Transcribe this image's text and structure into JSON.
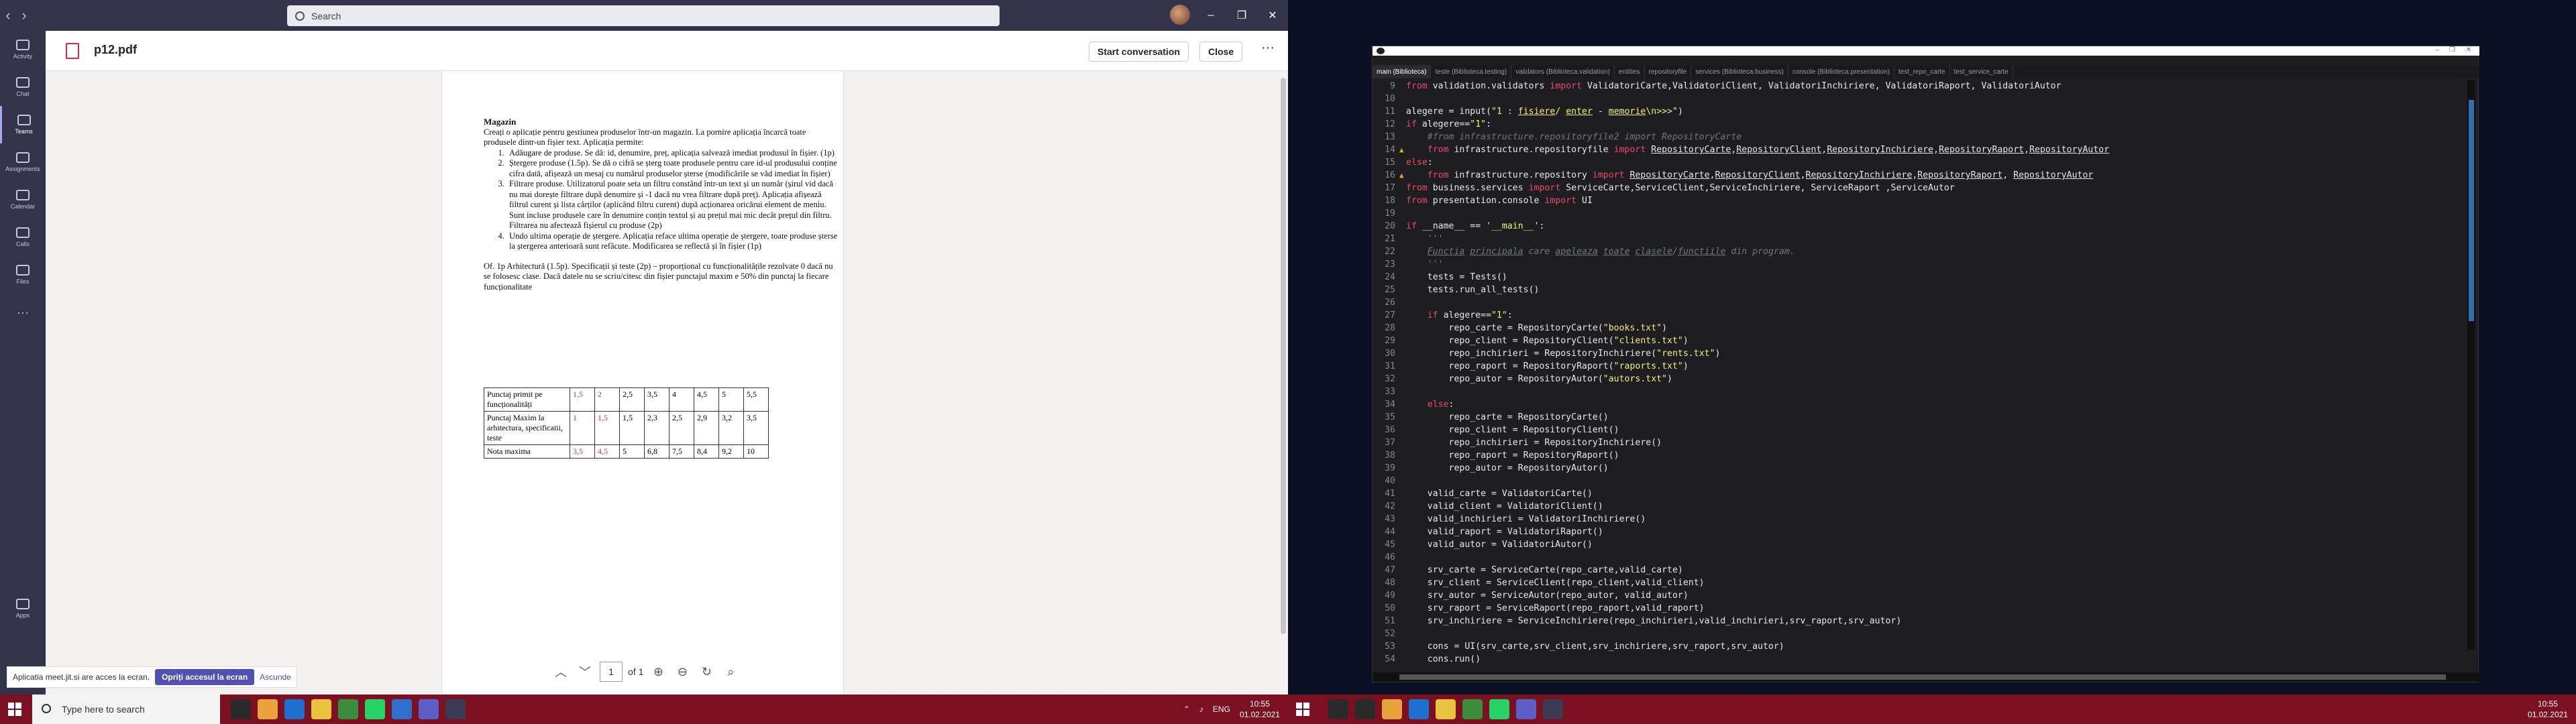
{
  "teams": {
    "search_placeholder": "Search",
    "window_buttons": [
      "–",
      "❐",
      "✕"
    ],
    "rail": [
      "Activity",
      "Chat",
      "Teams",
      "Assignments",
      "Calendar",
      "Calls",
      "Files",
      "Apps"
    ],
    "doc_title": "p12.pdf",
    "start_conversation": "Start conversation",
    "close": "Close",
    "pdf": {
      "heading": "Magazin",
      "intro": "Creați o aplicație pentru gestiunea produselor într-un magazin. La pornire aplicația încarcă toate produsele dintr-un fișier text. Aplicația permite:",
      "items": [
        "Adăugare de produse. Se dă: id, denumire, preț, aplicația salvează imediat produsul în fișier. (1p)",
        "Ștergere produse (1.5p). Se dă o cifră se șterg toate produsele pentru care id-ul produsului conține cifra dată, afișează un mesaj cu numărul produselor șterse (modificările se văd imediat în fișier)",
        "Filtrare produse. Utilizatorul poate seta un filtru constând într-un text și un număr (șirul vid dacă nu mai dorește filtrare după denumire și -1 dacă nu vrea filtrare după preț). Aplicația afișează filtrul curent și lista cărților (aplicând filtru curent) după acționarea oricărui element de meniu. Sunt incluse produsele care în denumire conțin textul și au prețul mai mic decât prețul din filtru. Filtrarea nu afectează fișierul cu produse (2p)",
        "Undo ultima operație de ștergere. Aplicația reface ultima operație de ștergere, toate produse șterse la ștergerea anterioară sunt refăcute. Modificarea se reflectă și în fișier (1p)"
      ],
      "footer": "Of. 1p Arhitectură (1.5p). Specificații și teste (2p) – proporțional cu funcționalitățile rezolvate 0 dacă nu se folosesc clase. Dacă datele nu se scriu/citesc din fișier punctajul maxim e 50% din punctaj la fiecare funcționalitate",
      "table": [
        [
          "Punctaj primit pe funcționalități",
          "1,5",
          "2",
          "2,5",
          "3,5",
          "4",
          "4,5",
          "5",
          "5,5"
        ],
        [
          "Punctaj Maxim la arhitectura, specificatii, teste",
          "1",
          "1,5",
          "1,5",
          "2,3",
          "2,5",
          "2,9",
          "3,2",
          "3,5"
        ],
        [
          "Nota maxima",
          "3,5",
          "4,5",
          "5",
          "6,8",
          "7,5",
          "8,4",
          "9,2",
          "10"
        ]
      ],
      "page_num": "1",
      "page_of": "of 1"
    },
    "notification": {
      "text": "Aplicatia meet.jit.si are acces la ecran.",
      "share": "Opriți accesul la ecran",
      "hide": "Ascunde"
    },
    "taskbar": {
      "search": "Type here to search",
      "lang": "ENG",
      "time": "10:55",
      "date": "01.02.2021"
    }
  },
  "ide": {
    "tabs": [
      "main (Biblioteca)",
      "teste (Biblioteca.testing)",
      "validators (Biblioteca.validation)",
      "entities",
      "repositoryfile",
      "services (Biblioteca.business)",
      "console (Biblioteca.presentation)",
      "test_repo_carte",
      "test_service_carte"
    ],
    "taskbar_time": "10:55",
    "taskbar_date": "01.02.2021"
  }
}
